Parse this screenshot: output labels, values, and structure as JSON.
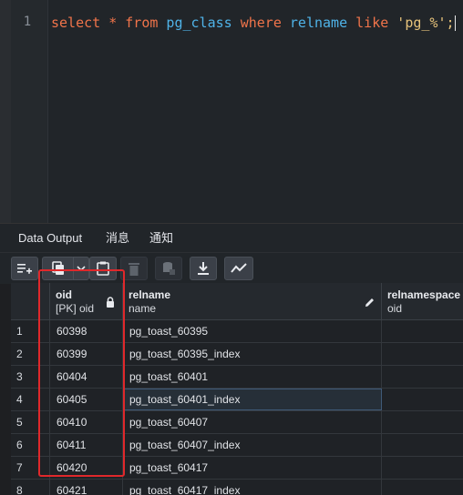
{
  "editor": {
    "line_number": "1",
    "tokens": [
      {
        "text": "select",
        "cls": "kw"
      },
      {
        "text": " * ",
        "cls": "op"
      },
      {
        "text": "from",
        "cls": "kw"
      },
      {
        "text": " pg_class ",
        "cls": "id"
      },
      {
        "text": "where",
        "cls": "kw"
      },
      {
        "text": " relname ",
        "cls": "id"
      },
      {
        "text": "like",
        "cls": "kw"
      },
      {
        "text": " 'pg_%'",
        "cls": "str"
      },
      {
        "text": ";",
        "cls": "str"
      }
    ]
  },
  "tabs": {
    "data_output": "Data Output",
    "messages": "消息",
    "notifications": "通知"
  },
  "toolbar": {
    "buttons": [
      "add-row",
      "copy",
      "copy-dropdown",
      "paste",
      "delete",
      "save-data",
      "download",
      "graph"
    ]
  },
  "grid": {
    "columns": [
      {
        "name": "oid",
        "type": "[PK] oid",
        "icon": "lock-icon"
      },
      {
        "name": "relname",
        "type": "name",
        "icon": "pencil-icon"
      },
      {
        "name": "relnamespace",
        "type": "oid",
        "icon": ""
      }
    ],
    "rows": [
      {
        "num": "1",
        "oid": "60398",
        "relname": "pg_toast_60395"
      },
      {
        "num": "2",
        "oid": "60399",
        "relname": "pg_toast_60395_index"
      },
      {
        "num": "3",
        "oid": "60404",
        "relname": "pg_toast_60401"
      },
      {
        "num": "4",
        "oid": "60405",
        "relname": "pg_toast_60401_index"
      },
      {
        "num": "5",
        "oid": "60410",
        "relname": "pg_toast_60407"
      },
      {
        "num": "6",
        "oid": "60411",
        "relname": "pg_toast_60407_index"
      },
      {
        "num": "7",
        "oid": "60420",
        "relname": "pg_toast_60417"
      },
      {
        "num": "8",
        "oid": "60421",
        "relname": "pg_toast_60417_index"
      }
    ],
    "selected_row": "4"
  },
  "colors": {
    "highlight_box": "#e0282b",
    "keyword": "#f0744a",
    "identifier": "#4fb3e8",
    "string": "#e6c27a"
  }
}
